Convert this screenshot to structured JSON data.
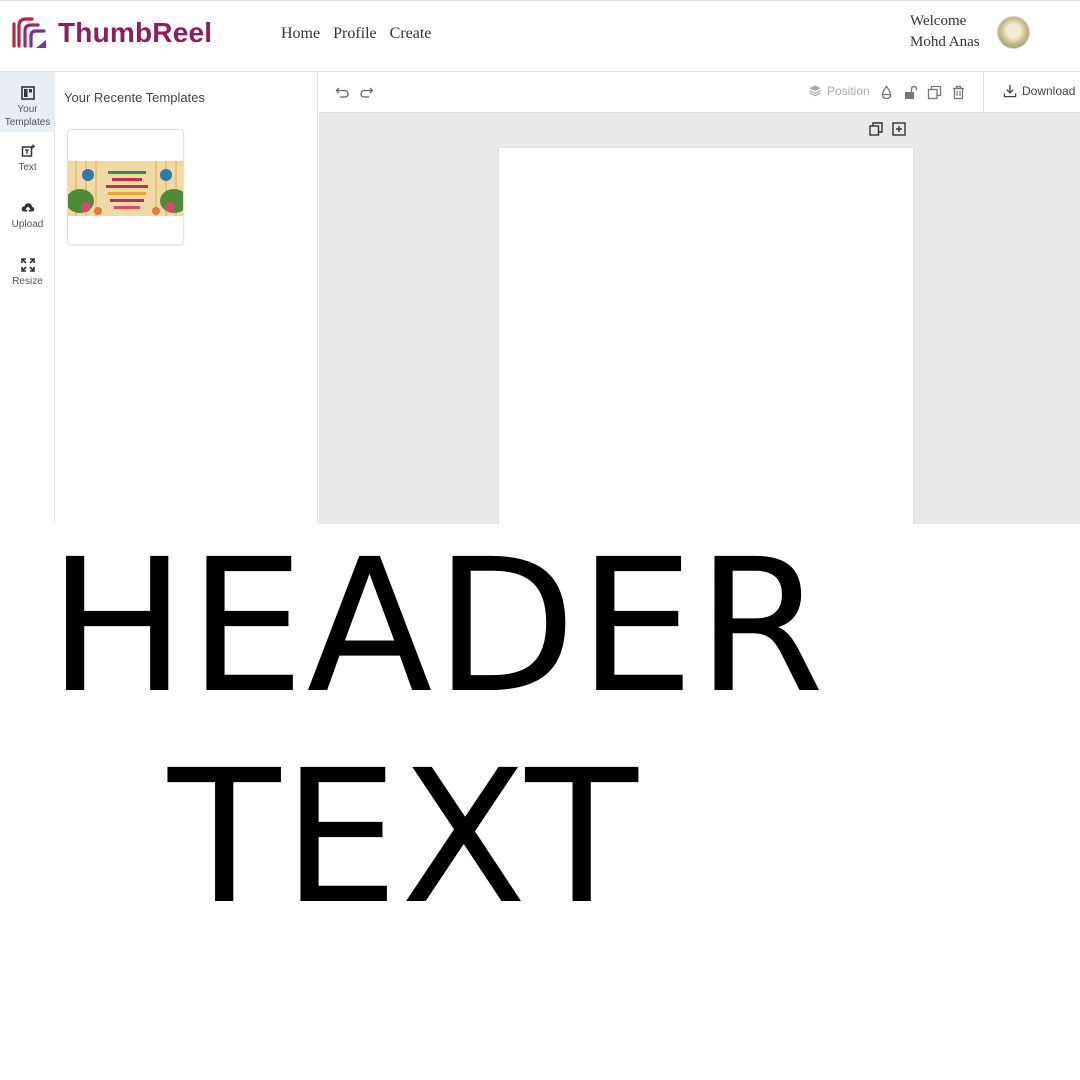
{
  "brand": {
    "name": "ThumbReel"
  },
  "nav": {
    "home": "Home",
    "profile": "Profile",
    "create": "Create"
  },
  "user": {
    "welcome": "Welcome",
    "name": "Mohd Anas"
  },
  "rail": {
    "items": [
      {
        "line1": "Your",
        "line2": "Templates"
      },
      {
        "line1": "Text"
      },
      {
        "line1": "Upload"
      },
      {
        "line1": "Resize"
      }
    ]
  },
  "panel": {
    "title": "Your Recente Templates"
  },
  "toolbar": {
    "position": "Position",
    "download": "Download"
  },
  "overlay": {
    "line1": "HEADER",
    "line2": "TEXT"
  },
  "colors": {
    "brand": "#8b1e5f",
    "workspace": "#e9e9e9",
    "active_rail": "#e9eef6"
  }
}
